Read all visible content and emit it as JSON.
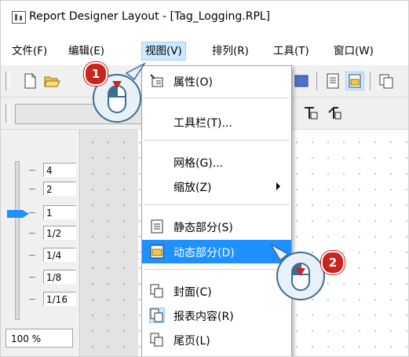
{
  "window": {
    "title": "Report Designer Layout - [Tag_Logging.RPL]"
  },
  "menubar": {
    "items": [
      "文件(F)",
      "编辑(E)",
      "视图(V)",
      "排列(R)",
      "工具(T)",
      "窗口(W)"
    ],
    "active_index": 2
  },
  "zoom": {
    "levels": [
      "4",
      "2",
      "1",
      "1/2",
      "1/4",
      "1/8",
      "1/16"
    ],
    "current_value": "100 %",
    "slider_level": "1"
  },
  "view_menu": {
    "items": [
      {
        "label": "属性(O)",
        "icon": "properties-icon"
      },
      {
        "label": "工具栏(T)...",
        "icon": ""
      },
      {
        "label": "网格(G)...",
        "icon": ""
      },
      {
        "label": "缩放(Z)",
        "icon": "",
        "submenu": true
      },
      {
        "label": "静态部分(S)",
        "icon": "static-part-icon"
      },
      {
        "label": "动态部分(D)",
        "icon": "dynamic-part-icon",
        "highlighted": true
      },
      {
        "label": "封面(C)",
        "icon": "cover-page-icon"
      },
      {
        "label": "报表内容(R)",
        "icon": "report-contents-icon"
      },
      {
        "label": "尾页(L)",
        "icon": "final-page-icon"
      }
    ]
  },
  "callouts": [
    {
      "number": "1"
    },
    {
      "number": "2"
    }
  ],
  "colors": {
    "highlight": "#1e90ff",
    "badge": "#c8251e",
    "menu_active_bg": "#cde8ff"
  }
}
